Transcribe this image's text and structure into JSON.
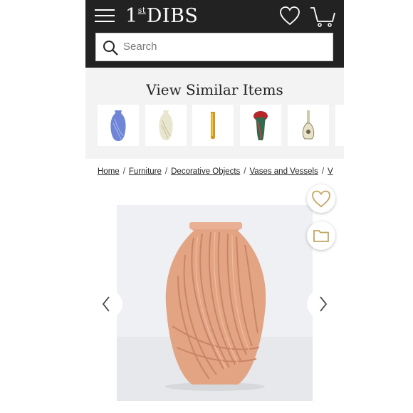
{
  "header": {
    "logo_number": "1",
    "logo_st": "st",
    "logo_text": "DIBS",
    "menu_icon": "hamburger-icon",
    "favorites_icon": "heart-icon",
    "cart_icon": "cart-icon"
  },
  "search": {
    "placeholder": "Search",
    "icon": "search-icon"
  },
  "similar": {
    "title": "View Similar Items",
    "items": [
      {
        "icon": "blue-vase-thumbnail"
      },
      {
        "icon": "cream-vase-thumbnail"
      },
      {
        "icon": "amber-vase-thumbnail"
      },
      {
        "icon": "red-glass-vase-thumbnail"
      },
      {
        "icon": "bud-vase-thumbnail"
      }
    ]
  },
  "breadcrumb": {
    "items": [
      "Home",
      "Furniture",
      "Decorative Objects",
      "Vases and Vessels",
      "V"
    ],
    "separator": "/"
  },
  "actions": {
    "favorite_icon": "heart-icon",
    "folder_icon": "folder-icon"
  },
  "gallery": {
    "prev_icon": "chevron-left-icon",
    "next_icon": "chevron-right-icon",
    "photo": "peach-shell-vase-photo"
  },
  "colors": {
    "header_bg": "#222222",
    "accent_gold": "#c2a661",
    "vase_peach": "#e3a484"
  }
}
